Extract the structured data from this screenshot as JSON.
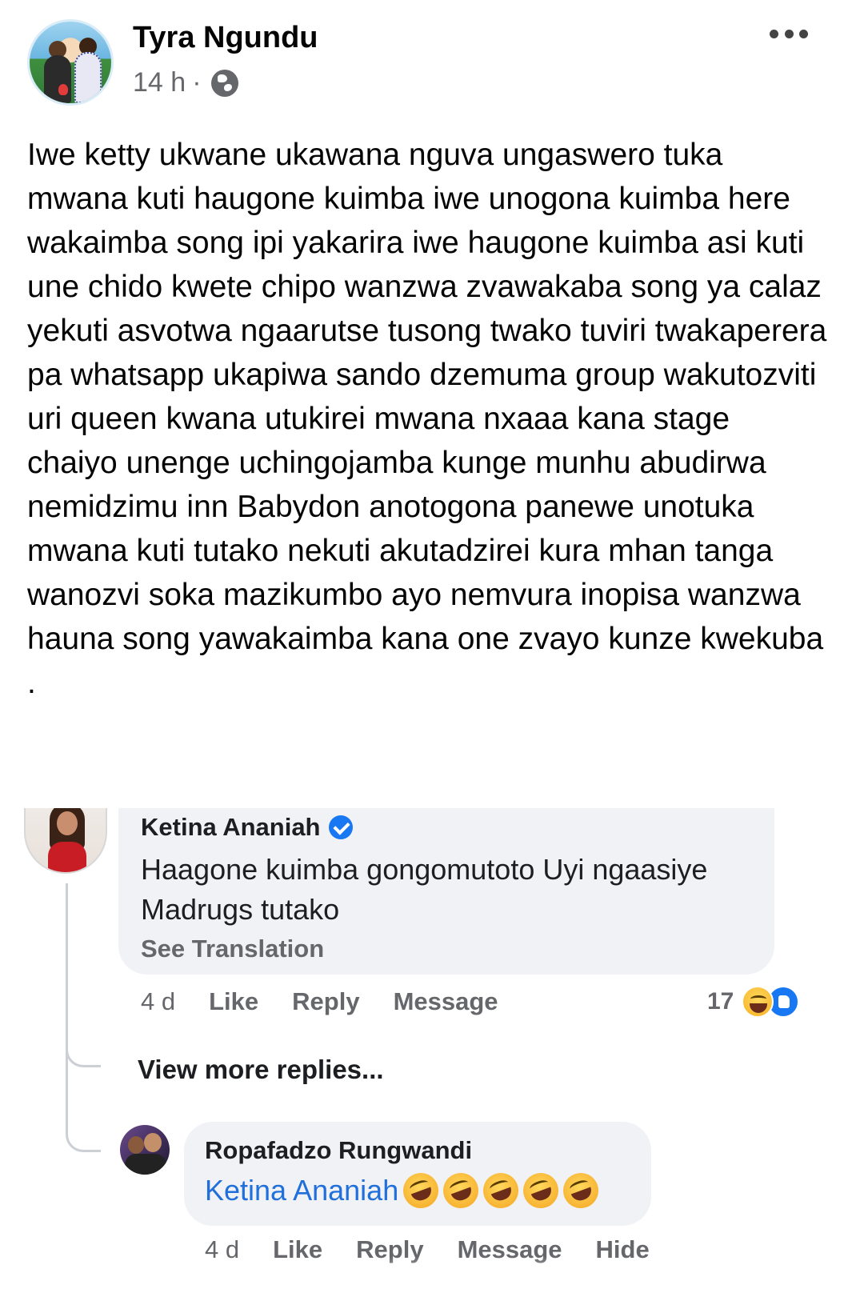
{
  "post": {
    "author": "Tyra Ngundu",
    "time": "14 h",
    "separator": "·",
    "body": "Iwe ketty ukwane ukawana nguva ungaswero tuka mwana kuti haugone kuimba iwe unogona kuimba here wakaimba song ipi yakarira iwe haugone kuimba asi kuti une  chido kwete chipo wanzwa zvawakaba song ya calaz yekuti asvotwa ngaarutse tusong twako tuviri twakaperera pa whatsapp ukapiwa sando dzemuma group wakutozviti uri queen kwana utukirei mwana nxaaa kana stage chaiyo unenge uchingojamba kunge munhu abudirwa nemidzimu inn Babydon anotogona panewe unotuka mwana kuti tutako nekuti akutadzirei kura mhan tanga wanozvi soka mazikumbo ayo nemvura inopisa wanzwa hauna song yawakaimba kana one zvayo kunze kwekuba ."
  },
  "comment1": {
    "author": "Ketina Ananiah",
    "text": "Haagone kuimba gongomutoto Uyi ngaasiye Madrugs tutako",
    "see_translation": "See Translation",
    "time": "4 d",
    "like": "Like",
    "reply": "Reply",
    "message": "Message",
    "reaction_count": "17"
  },
  "view_more_replies": "View more replies...",
  "comment2": {
    "author": "Ropafadzo Rungwandi",
    "mention": "Ketina Ananiah",
    "time": "4 d",
    "like": "Like",
    "reply": "Reply",
    "message": "Message",
    "hide": "Hide"
  },
  "colors": {
    "link": "#216fdb",
    "secondary_text": "#65676b",
    "bubble": "#f0f2f5",
    "like_blue": "#1877f2"
  },
  "icons": [
    "globe-icon",
    "more-icon",
    "verified-icon",
    "haha-icon",
    "like-icon",
    "rofl-icon"
  ]
}
